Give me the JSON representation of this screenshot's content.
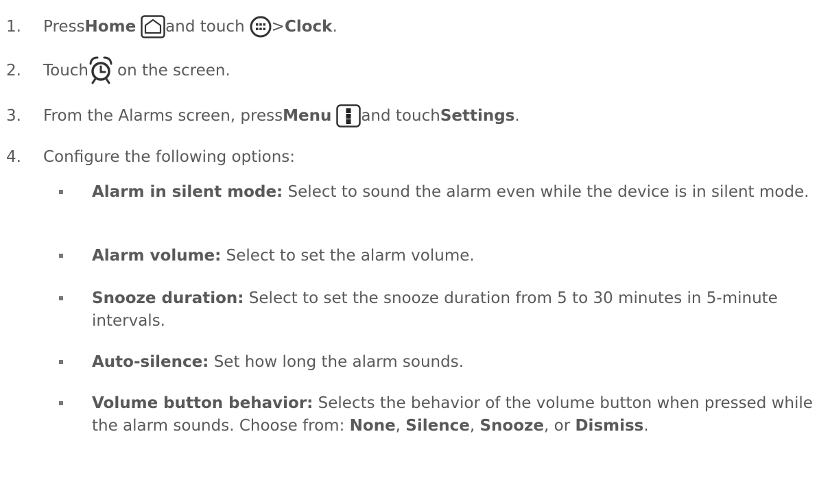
{
  "steps": [
    {
      "num": "1.",
      "parts": {
        "a": "Press ",
        "b": "Home",
        "c": " and touch ",
        "d": " > ",
        "e": "Clock",
        "f": "."
      }
    },
    {
      "num": "2.",
      "parts": {
        "a": "Touch ",
        "b": " on the screen."
      }
    },
    {
      "num": "3.",
      "parts": {
        "a": "From the Alarms screen, press ",
        "b": "Menu",
        "c": " and touch ",
        "d": "Settings",
        "e": "."
      }
    },
    {
      "num": "4.",
      "parts": {
        "a": "Configure the following options:"
      }
    }
  ],
  "options": [
    {
      "term": "Alarm in silent mode:",
      "desc": " Select to sound the alarm even while the device is in silent mode."
    },
    {
      "term": "Alarm volume:",
      "desc": " Select to set the alarm volume."
    },
    {
      "term": "Snooze duration:",
      "desc": " Select to set the snooze duration from 5 to 30 minutes in 5-minute intervals."
    },
    {
      "term": "Auto-silence:",
      "desc": " Set how long the alarm sounds."
    }
  ],
  "last_option": {
    "term": "Volume button behavior:",
    "desc": " Selects the behavior of the volume button when pressed while the alarm sounds. Choose from: ",
    "choice1": "None",
    "sep1": ", ",
    "choice2": "Silence",
    "sep2": ", ",
    "choice3": "Snooze",
    "sep3": ", or ",
    "choice4": "Dismiss",
    "end": "."
  }
}
